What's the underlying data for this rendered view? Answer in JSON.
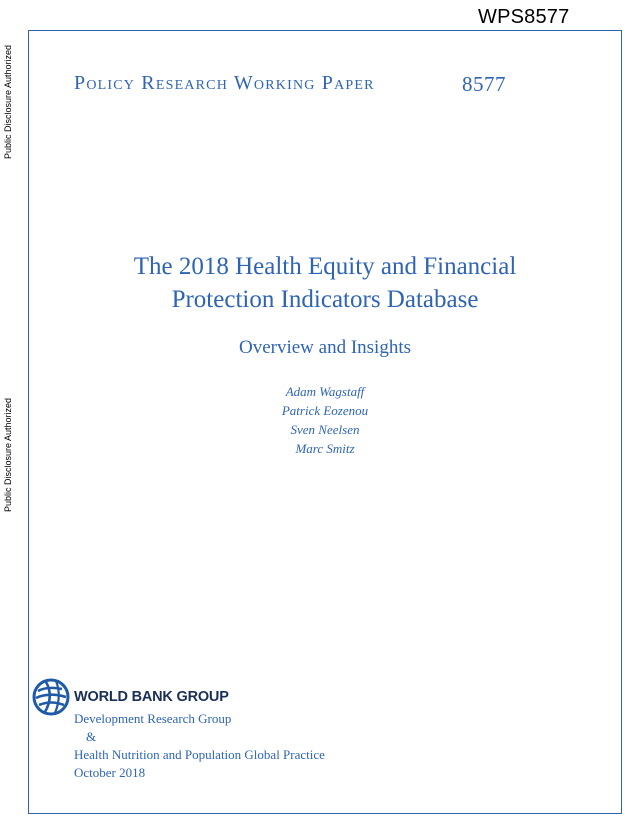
{
  "document": {
    "report_number": "WPS8577",
    "disclosure_labels": [
      "Public Disclosure Authorized",
      "Public Disclosure Authorized"
    ],
    "series_name": "Policy Research Working Paper",
    "series_number": "8577",
    "title_line1": "The 2018 Health Equity and Financial",
    "title_line2": "Protection Indicators Database",
    "subtitle": "Overview and Insights",
    "authors": [
      "Adam Wagstaff",
      "Patrick Eozenou",
      "Sven Neelsen",
      "Marc Smitz"
    ],
    "logo_text": "WORLD BANK GROUP",
    "publisher_lines": [
      "Development Research Group",
      "&",
      "Health Nutrition and Population Global Practice",
      "October 2018"
    ]
  },
  "colors": {
    "accent": "#2f64b5",
    "logo_text": "#1a2f55",
    "logo_globe": "#1f5aa8"
  },
  "icons": {
    "logo": "world-bank-globe-icon"
  }
}
